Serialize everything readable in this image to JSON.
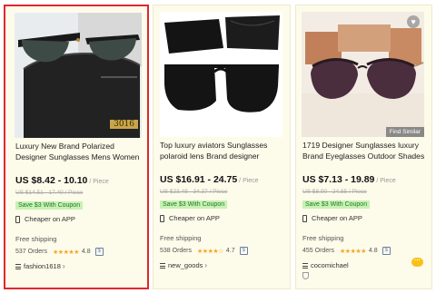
{
  "products": [
    {
      "title": "Luxury New Brand Polarized Designer Sunglasses Mens Women",
      "price": "US $8.42 - 10.10",
      "price_unit": " / Piece",
      "original_price": "US $14.51 - 17.40 / Piece",
      "coupon": "Save $3 With Coupon",
      "app_note": "Cheaper on APP",
      "shipping": "Free shipping",
      "orders": "537 Orders",
      "stars": "★★★★★",
      "rating": "4.8",
      "store": "fashion1618",
      "image_label": "3016",
      "selected": true
    },
    {
      "title": "Top luxury aviators Sunglasses polaroid lens Brand designer",
      "price": "US $16.91 - 24.75",
      "price_unit": " / Piece",
      "original_price": "US $23.48 - 34.37 / Piece",
      "coupon": "Save $3 With Coupon",
      "app_note": "Cheaper on APP",
      "shipping": "Free shipping",
      "orders": "538 Orders",
      "stars": "★★★★☆",
      "rating": "4.7",
      "store": "new_goods",
      "selected": false
    },
    {
      "title": "1719 Designer Sunglasses luxury Brand Eyeglasses Outdoor Shades",
      "price": "US $7.13 - 19.89",
      "price_unit": " / Piece",
      "original_price": "US $8.90 - 24.85 / Piece",
      "coupon": "Save $3 With Coupon",
      "app_note": "Cheaper on APP",
      "shipping": "Free shipping",
      "orders": "455 Orders",
      "stars": "★★★★★",
      "rating": "4.8",
      "store": "cocomichael",
      "find_similar": "Find Similar",
      "selected": false
    }
  ],
  "icons": {
    "phone": "phone-icon",
    "star": "star-icon",
    "dollar": "dollar-badge-icon",
    "store": "store-menu-icon",
    "heart": "heart-icon",
    "chat": "chat-icon",
    "shield": "shield-icon"
  },
  "colors": {
    "card_bg": "#fdfbea",
    "selected_border": "#e0262e",
    "coupon_bg": "#c9f1b3",
    "coupon_text": "#1c7a2e",
    "star": "#f5a623"
  }
}
